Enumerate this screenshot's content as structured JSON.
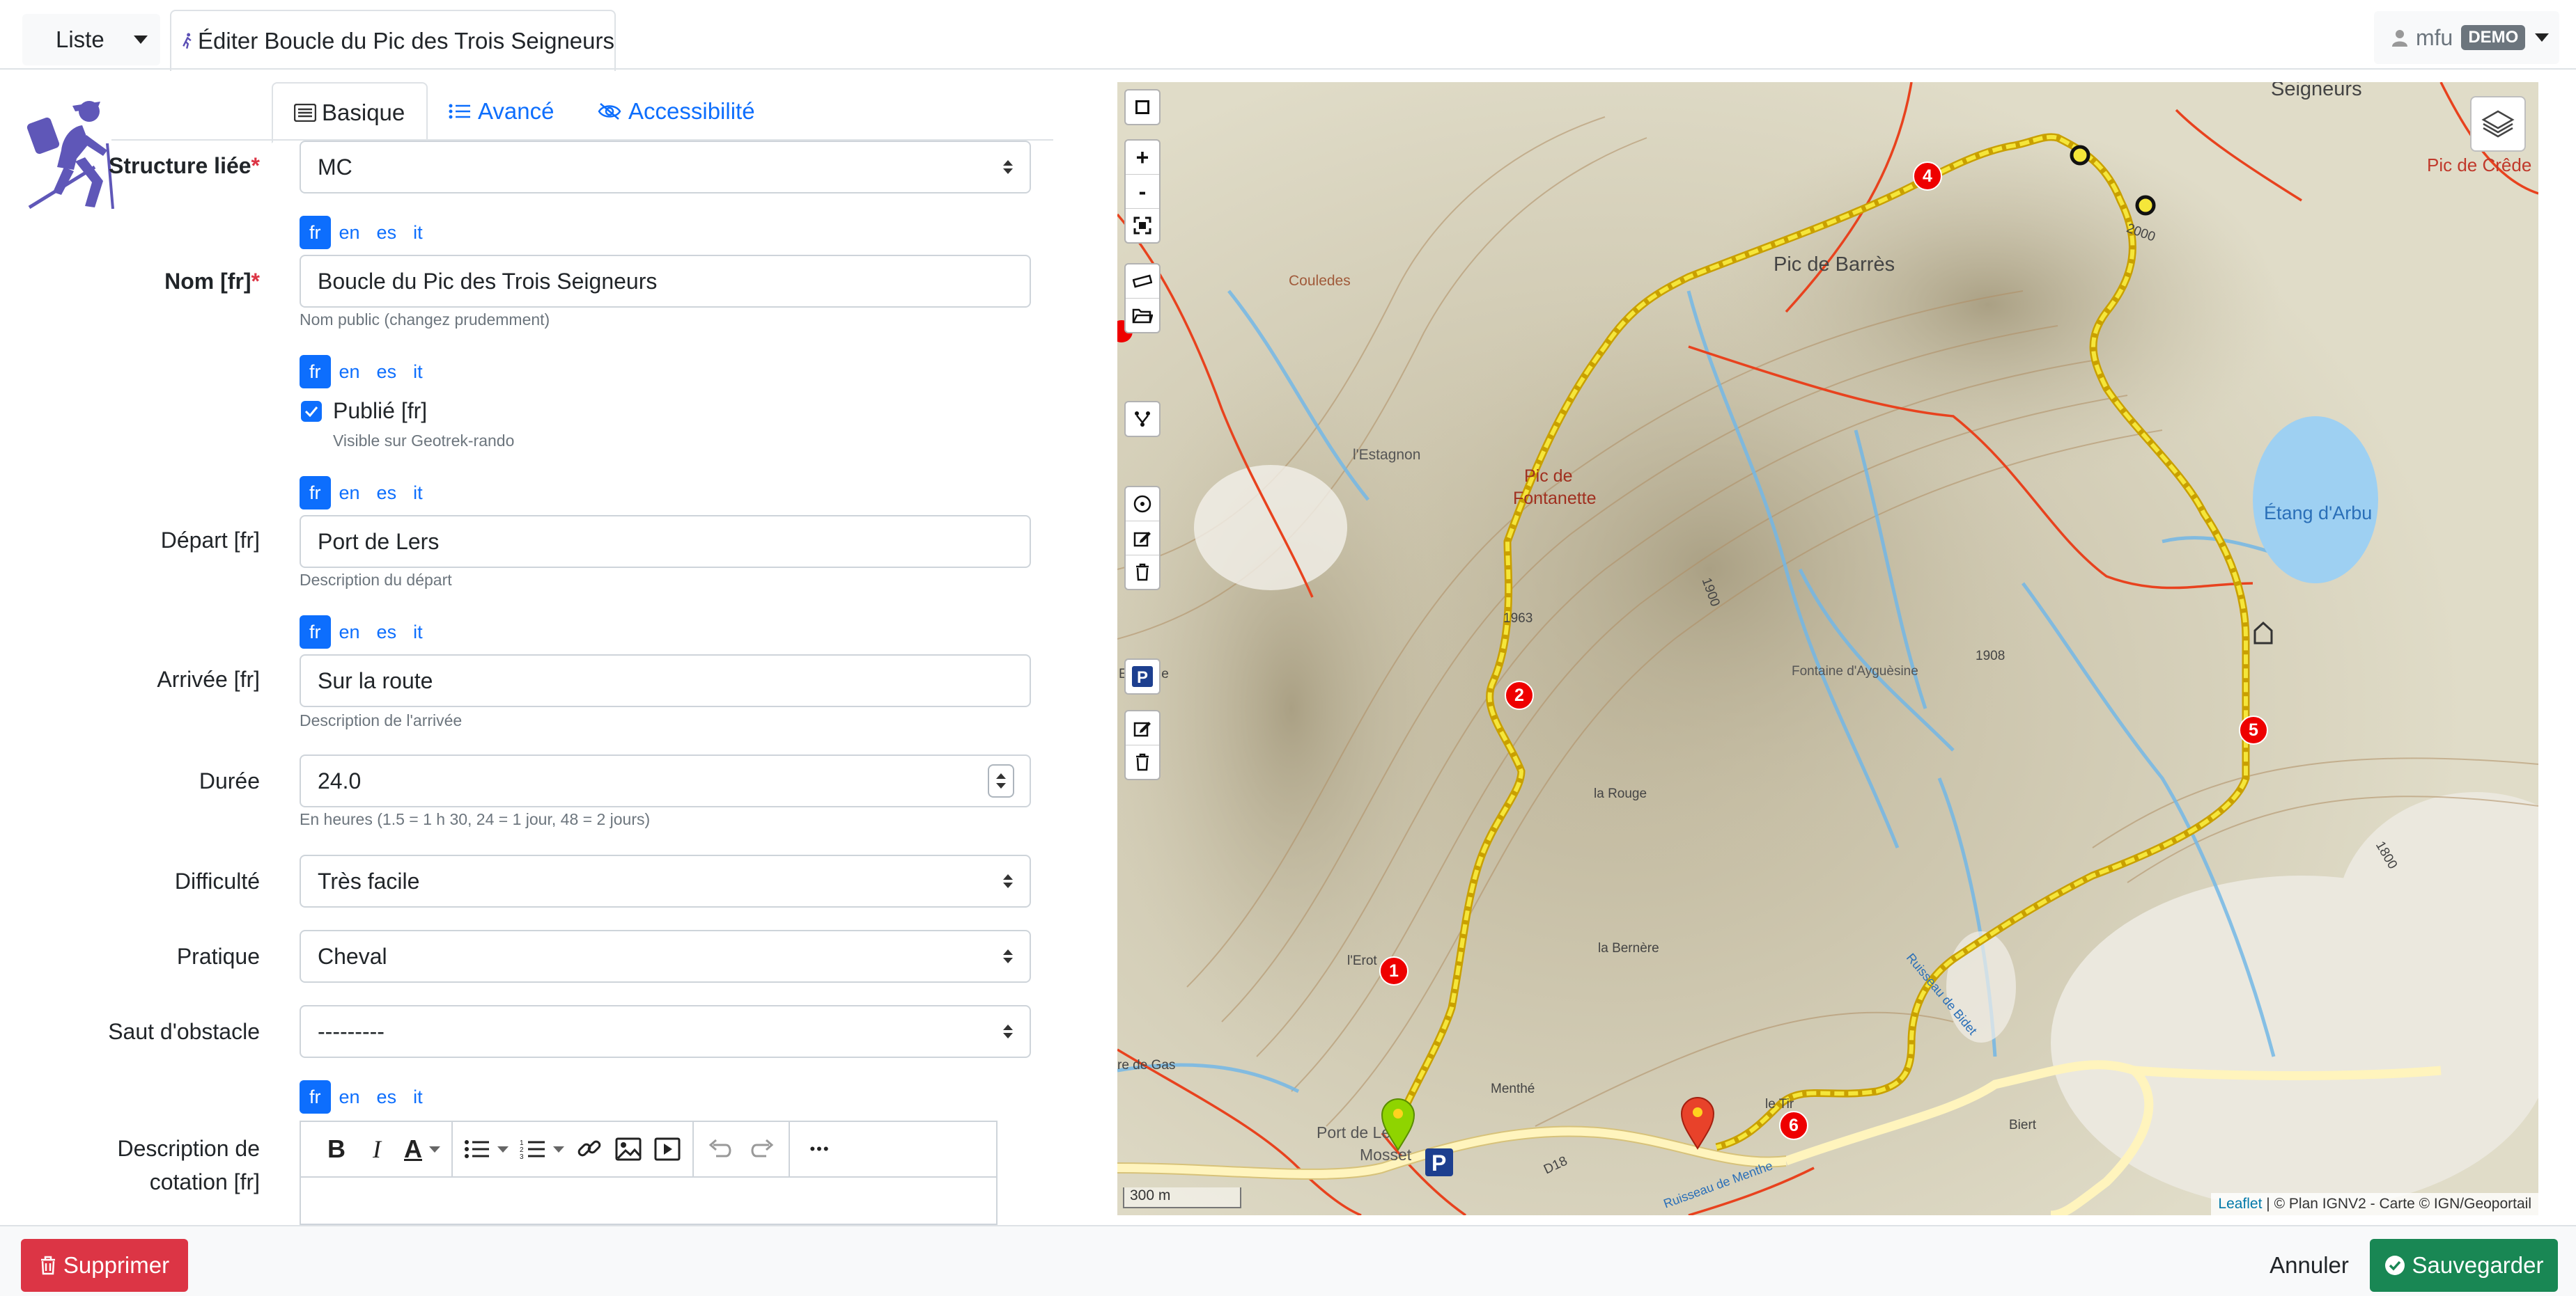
{
  "topbar": {
    "list_label": "Liste",
    "page_title": "Éditer Boucle du Pic des Trois Seigneurs",
    "user_name": "mfu",
    "user_badge": "DEMO"
  },
  "tabs": [
    {
      "label": "Basique",
      "active": true
    },
    {
      "label": "Avancé",
      "active": false
    },
    {
      "label": "Accessibilité",
      "active": false
    }
  ],
  "languages": [
    "fr",
    "en",
    "es",
    "it"
  ],
  "active_language": "fr",
  "form": {
    "structure": {
      "label": "Structure liée",
      "required_mark": "*",
      "value": "MC"
    },
    "name": {
      "label": "Nom [fr]",
      "required_mark": "*",
      "value": "Boucle du Pic des Trois Seigneurs",
      "help": "Nom public (changez prudemment)"
    },
    "published": {
      "label": "Publié [fr]",
      "checked": true,
      "help": "Visible sur Geotrek-rando"
    },
    "departure": {
      "label": "Départ [fr]",
      "value": "Port de Lers",
      "help": "Description du départ"
    },
    "arrival": {
      "label": "Arrivée [fr]",
      "value": "Sur la route",
      "help": "Description de l'arrivée"
    },
    "duration": {
      "label": "Durée",
      "value": "24.0",
      "help": "En heures (1.5 = 1 h 30, 24 = 1 jour, 48 = 2 jours)"
    },
    "difficulty": {
      "label": "Difficulté",
      "value": "Très facile"
    },
    "practice": {
      "label": "Pratique",
      "value": "Cheval"
    },
    "obstacle": {
      "label": "Saut d'obstacle",
      "value": "---------"
    },
    "rating_description": {
      "label_line1": "Description de",
      "label_line2": "cotation [fr]"
    }
  },
  "editor_toolbar": {
    "bold": "B",
    "italic": "I",
    "font_color": "A",
    "more": "•••"
  },
  "map": {
    "labels": {
      "seigneurs": "Seigneurs",
      "pic_crede": "Pic de Crêde",
      "pic_barres": "Pic de Barrès",
      "coulledes": "Couledes",
      "estagnon": "l'Estagnon",
      "pic_fontanette_1": "Pic de",
      "pic_fontanette_2": "Fontanette",
      "etang": "Étang d'Arbu",
      "fontaine": "Fontaine d'Ayguèsine",
      "estenille": "Estenille",
      "la_rouge": "la Rouge",
      "lerot": "l'Erot",
      "la_bernere": "la Bernère",
      "menthe": "Menthé",
      "port_lers_1": "Port de Lers",
      "port_lers_2": "Mosset",
      "biert": "Biert",
      "gas": "re de Gas",
      "le_tir": "le Tir",
      "ruisseau_menthe": "Ruisseau de Menthe",
      "ruisseau_right": "Ruisseau de Bidet",
      "d18": "D18",
      "alt_1963": "1963",
      "alt_1908": "1908",
      "alt_2000": "2000",
      "alt_1800": "1800",
      "alt_1900": "1900"
    },
    "poi_markers": [
      "1",
      "2",
      "4",
      "5",
      "6"
    ],
    "scale": "300 m",
    "attribution_link": "Leaflet",
    "attribution_text": "| © Plan IGNV2 - Carte © IGN/Geoportail"
  },
  "footer": {
    "delete_label": "Supprimer",
    "cancel_label": "Annuler",
    "save_label": "Sauvegarder"
  },
  "colors": {
    "primary": "#0d6efd",
    "danger": "#dc3545",
    "success": "#198754",
    "route": "#f5d90a",
    "poi": "#e00000"
  }
}
